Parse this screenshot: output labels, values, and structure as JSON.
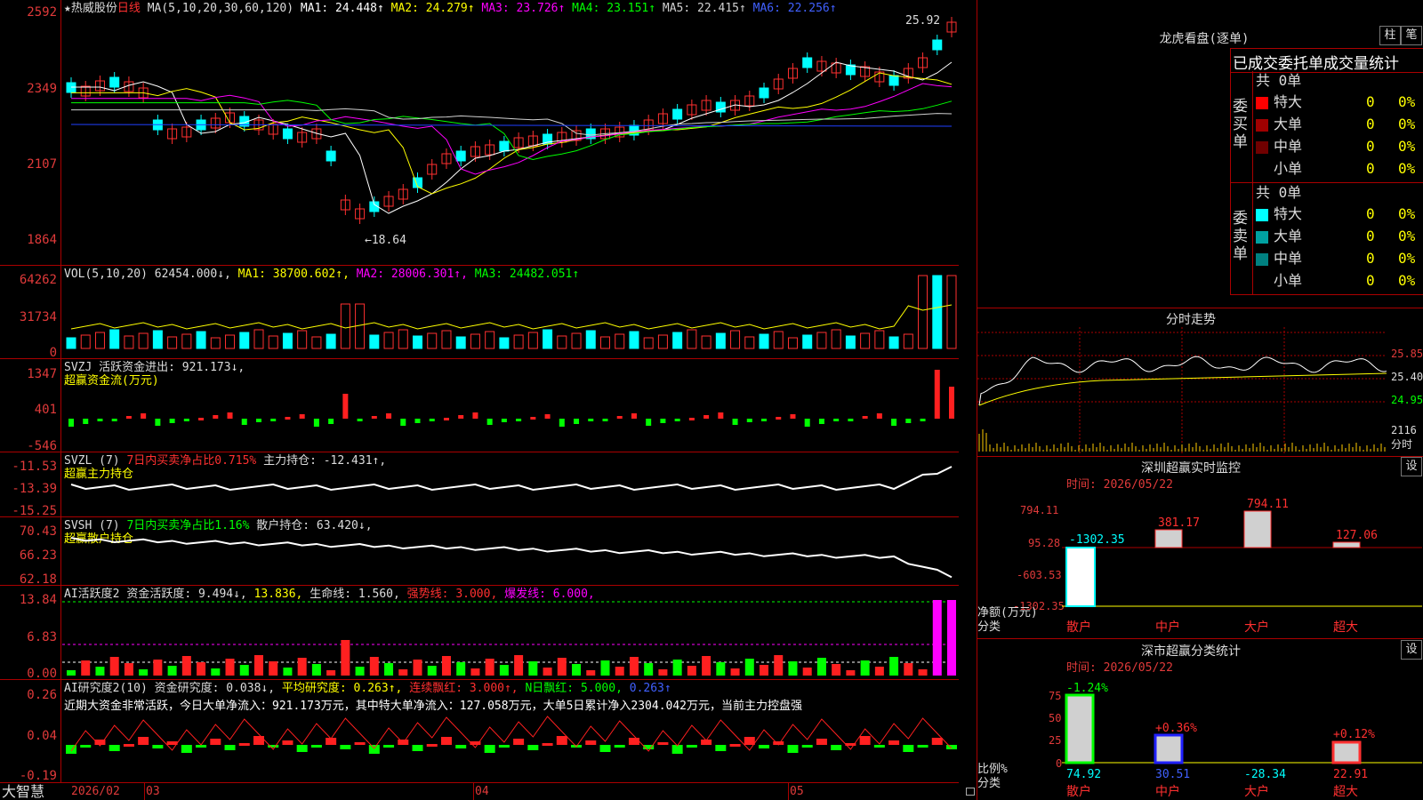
{
  "header": {
    "star": "★",
    "stock_name": "热威股份",
    "period": "日线",
    "ma_label": "MA(5,10,20,30,60,120)",
    "ma1": "MA1: 24.448↑",
    "ma2": "MA2: 24.279↑",
    "ma3": "MA3: 23.726↑",
    "ma4": "MA4: 23.151↑",
    "ma5": "MA5: 22.415↑",
    "ma6": "MA6: 22.256↑",
    "high_mark": "25.92",
    "low_mark": "←18.64",
    "colors": {
      "ma1": "#ffffff",
      "ma2": "#ffff00",
      "ma3": "#ff00ff",
      "ma4": "#00ff00",
      "ma5": "#d0d0d0",
      "ma6": "#0000ff"
    }
  },
  "price_axis": [
    "2592",
    "2349",
    "2107",
    "1864"
  ],
  "vol": {
    "label": "VOL(5,10,20)",
    "value": "62454.000↓,",
    "ma1": "MA1: 38700.602↑,",
    "ma2": "MA2: 28006.301↑,",
    "ma3": "MA3: 24482.051↑",
    "axis": [
      "64262",
      "31734",
      "0"
    ]
  },
  "svzj": {
    "label": "SVZJ",
    "text": "活跃资金进出: 921.173↓,",
    "sub": "超赢资金流(万元)",
    "axis": [
      "1347",
      "401",
      "-546"
    ]
  },
  "svzl": {
    "label": "SVZL (7)",
    "pct": "7日内买卖净占比0.715%",
    "text": "主力持仓: -12.431↑,",
    "sub": "超赢主力持仓",
    "axis": [
      "-11.53",
      "-13.39",
      "-15.25"
    ]
  },
  "svsh": {
    "label": "SVSH (7)",
    "pct": "7日内买卖净占比1.16%",
    "text": "散户持仓: 63.420↓,",
    "sub": "超赢散户持仓",
    "axis": [
      "70.43",
      "66.23",
      "62.18"
    ]
  },
  "ai1": {
    "label": "AI活跃度2",
    "text1": "资金活跃度: 9.494↓,",
    "text2": "13.836,",
    "text3": "生命线: 1.560,",
    "text4": "强势线: 3.000,",
    "text5": "爆发线: 6.000,",
    "axis": [
      "13.84",
      "6.83",
      "0.00"
    ]
  },
  "ai2": {
    "label": "AI研究度2(10)",
    "text1": "资金研究度: 0.038↓,",
    "text2": "平均研究度: 0.263↑,",
    "text3": "连续飘红: 3.000↑,",
    "text4": "N日飘红: 5.000,",
    "text5": "0.263↑",
    "comment": "近期大资金非常活跃，今日大单净流入：921.173万元，其中特大单净流入：127.058万元，大单5日累计净入2304.042万元，当前主力控盘强",
    "axis": [
      "0.26",
      "0.04",
      "-0.19"
    ]
  },
  "footer": {
    "brand": "大智慧",
    "dates": [
      "2026/02",
      "03",
      "04",
      "05"
    ]
  },
  "right": {
    "lhb_title": "龙虎看盘(逐单)",
    "btn_zhu": "柱",
    "btn_bi": "笔",
    "tabs": [
      "已成交",
      "委托单",
      "成交量",
      "统计"
    ],
    "buy": {
      "vlabel": "委买单",
      "total": "共 0单",
      "rows": [
        {
          "name": "特大",
          "val": "0",
          "pct": "0%",
          "color": "#ff0000"
        },
        {
          "name": "大单",
          "val": "0",
          "pct": "0%",
          "color": "#a00000"
        },
        {
          "name": "中单",
          "val": "0",
          "pct": "0%",
          "color": "#700000"
        },
        {
          "name": "小单",
          "val": "0",
          "pct": "0%",
          "color": "#000000"
        }
      ]
    },
    "sell": {
      "vlabel": "委卖单",
      "total": "共 0单",
      "rows": [
        {
          "name": "特大",
          "val": "0",
          "pct": "0%",
          "color": "#00ffff"
        },
        {
          "name": "大单",
          "val": "0",
          "pct": "0%",
          "color": "#00a0a0"
        },
        {
          "name": "中单",
          "val": "0",
          "pct": "0%",
          "color": "#008080"
        },
        {
          "name": "小单",
          "val": "0",
          "pct": "0%",
          "color": "#000000"
        }
      ]
    },
    "intraday": {
      "title": "分时走势",
      "axis": [
        "25.85",
        "25.40",
        "24.95",
        "2116",
        "分时"
      ]
    },
    "monitor": {
      "title": "深圳超赢实时监控",
      "set": "设",
      "time": "时间: 2026/05/22",
      "axis": [
        "794.11",
        "95.28",
        "-603.53",
        "-1302.35"
      ],
      "ylabel": "净额(万元)",
      "xlabel": "分类",
      "bars": [
        {
          "cat": "散户",
          "value": "-1302.35"
        },
        {
          "cat": "中户",
          "value": "381.17"
        },
        {
          "cat": "大户",
          "value": "794.11"
        },
        {
          "cat": "超大",
          "value": "127.06"
        }
      ]
    },
    "stats": {
      "title": "深市超赢分类统计",
      "set": "设",
      "time": "时间: 2026/05/22",
      "axis": [
        "75",
        "50",
        "25",
        "0"
      ],
      "ylabel": "比例%",
      "xlabel": "分类",
      "bars": [
        {
          "cat": "散户",
          "top": "-1.24%",
          "bottom": "74.92"
        },
        {
          "cat": "中户",
          "top": "+0.36%",
          "bottom": "30.51"
        },
        {
          "cat": "大户",
          "top": "",
          "bottom": "-28.34"
        },
        {
          "cat": "超大",
          "top": "+0.12%",
          "bottom": "22.91"
        }
      ]
    }
  }
}
